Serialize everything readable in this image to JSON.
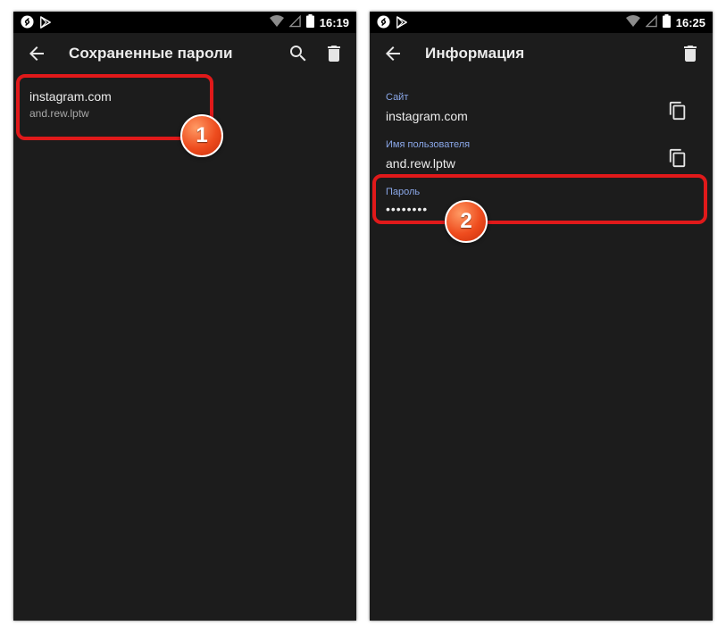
{
  "left_screen": {
    "status_time": "16:19",
    "title": "Сохраненные пароли",
    "item": {
      "site": "instagram.com",
      "username": "and.rew.lptw"
    },
    "badge": "1"
  },
  "right_screen": {
    "status_time": "16:25",
    "title": "Информация",
    "site_label": "Сайт",
    "site_value": "instagram.com",
    "username_label": "Имя пользователя",
    "username_value": "and.rew.lptw",
    "password_label": "Пароль",
    "password_value": "••••••••",
    "badge": "2"
  },
  "colors": {
    "background": "#1c1c1c",
    "status_bar": "#000000",
    "text_primary": "#ececec",
    "text_secondary": "#a8a8a8",
    "label_accent": "#8aa7e8",
    "highlight": "#e0191a",
    "badge": "#ee4c1e"
  },
  "icons": {
    "status_left": [
      "shazam-icon",
      "play-store-icon"
    ],
    "status_right": [
      "wifi-icon",
      "cellular-icon",
      "battery-icon"
    ],
    "toolbar": [
      "back-arrow-icon",
      "search-icon",
      "trash-icon"
    ],
    "detail": [
      "copy-icon"
    ]
  }
}
